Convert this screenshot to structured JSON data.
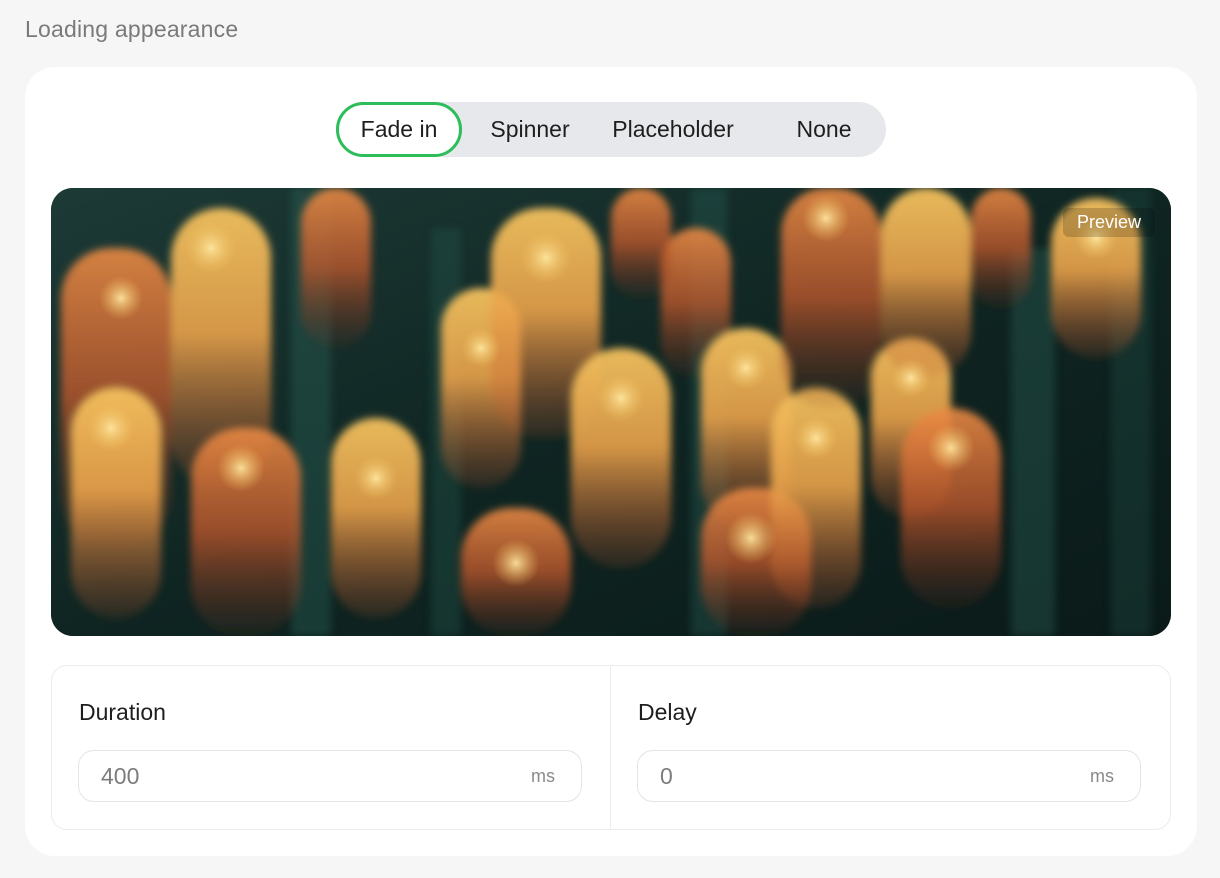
{
  "section": {
    "title": "Loading appearance"
  },
  "segmented": {
    "options": [
      "Fade in",
      "Spinner",
      "Placeholder",
      "None"
    ],
    "selected": "Fade in"
  },
  "preview": {
    "badge": "Preview"
  },
  "fields": {
    "duration": {
      "label": "Duration",
      "value": "400",
      "unit": "ms"
    },
    "delay": {
      "label": "Delay",
      "value": "0",
      "unit": "ms"
    }
  },
  "colors": {
    "accent": "#2ebd5b",
    "background": "#f6f6f6",
    "card": "#ffffff",
    "segment_track": "#e7e8eb"
  }
}
